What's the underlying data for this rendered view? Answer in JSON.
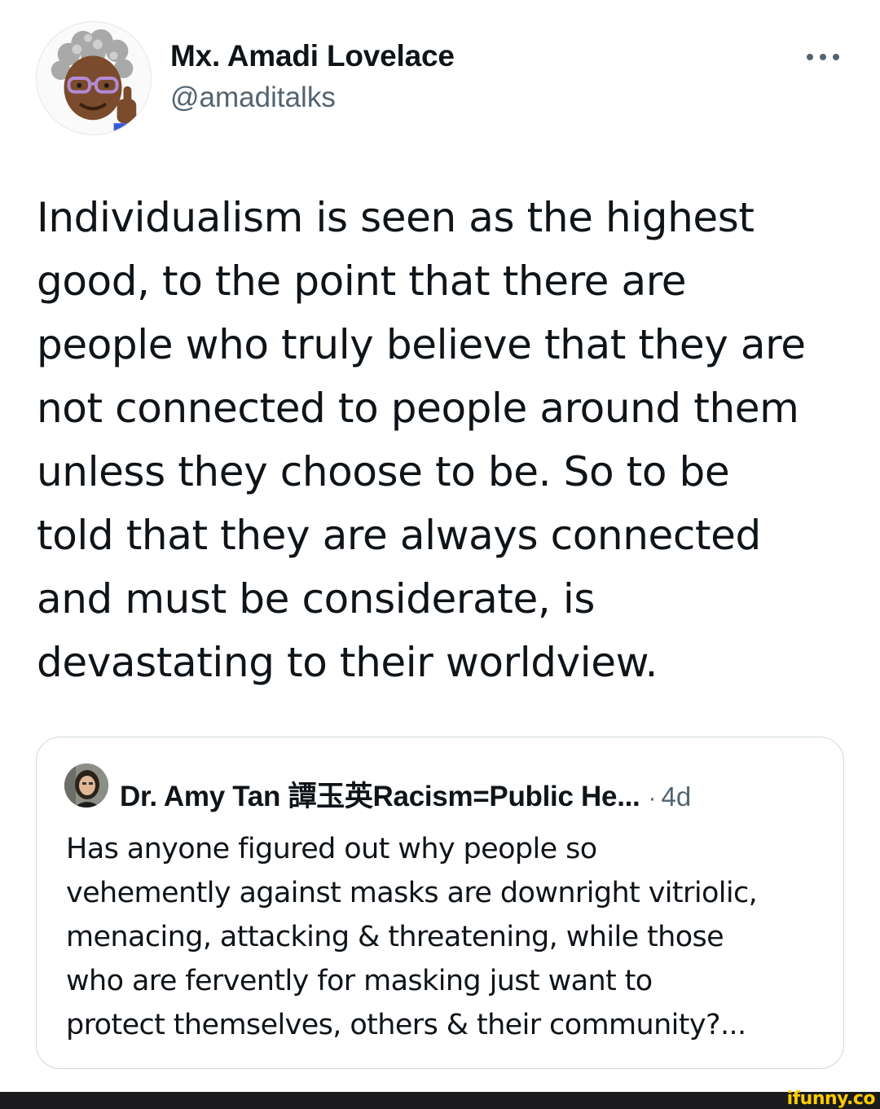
{
  "tweet": {
    "author": {
      "name": "Mx. Amadi Lovelace",
      "handle": "@amaditalks",
      "avatar_icon": "memoji-avatar-icon"
    },
    "more_icon": "more-horizontal-icon",
    "text_lines": [
      "Individualism is seen as the highest",
      "good, to the point that there are",
      "people who truly believe that they are",
      "not connected to people around them",
      "unless they choose to be. So to be",
      "told that they are always connected",
      "and must be considerate, is",
      "devastating to their worldview."
    ]
  },
  "quote": {
    "author_name": "Dr. Amy Tan 譚玉英Racism=Public He...",
    "separator": "·",
    "time": "4d",
    "avatar_icon": "profile-photo-icon",
    "text_lines": [
      "Has anyone figured out why people so",
      "vehemently against masks are downright vitriolic,",
      "menacing, attacking  & threatening, while those",
      "who are fervently for masking just want to",
      "protect themselves, others & their community?..."
    ]
  },
  "watermark": "ifunny.co",
  "colors": {
    "text_primary": "#0f1419",
    "text_secondary": "#536471",
    "border": "#cfd9de",
    "footer_bar": "#1b1b1d",
    "watermark": "#ffcc00"
  }
}
